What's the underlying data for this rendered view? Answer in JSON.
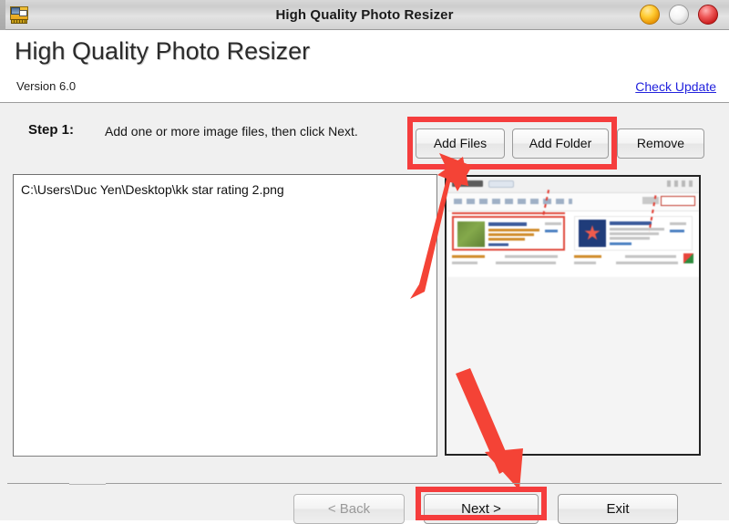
{
  "window": {
    "title": "High Quality Photo Resizer",
    "icon": "photo-resizer-icon",
    "controls": {
      "minimize": "minimize-button",
      "maximize": "maximize-button",
      "close": "close-button"
    }
  },
  "header": {
    "app_name": "High Quality Photo Resizer",
    "version": "Version 6.0",
    "check_update": "Check Update"
  },
  "step": {
    "label": "Step 1:",
    "instruction": "Add one or more image files, then click Next."
  },
  "toolbar": {
    "add_files": "Add Files",
    "add_folder": "Add Folder",
    "remove": "Remove"
  },
  "file_list": {
    "items": [
      "C:\\Users\\Duc Yen\\Desktop\\kk star rating 2.png"
    ]
  },
  "preview": {
    "description": "Thumbnail preview of selected image"
  },
  "footer": {
    "back": "< Back",
    "next": "Next >",
    "exit": "Exit"
  },
  "annotations": {
    "highlight_color": "#f53d3d",
    "arrow_color": "#f44336",
    "items": [
      "red-box-add-buttons",
      "red-arrow-to-add-files",
      "red-arrow-to-next",
      "red-box-next-button"
    ]
  },
  "colors": {
    "link": "#2222dd",
    "window_bg": "#f0f0f0",
    "titlebar": "#d8d8d8"
  }
}
